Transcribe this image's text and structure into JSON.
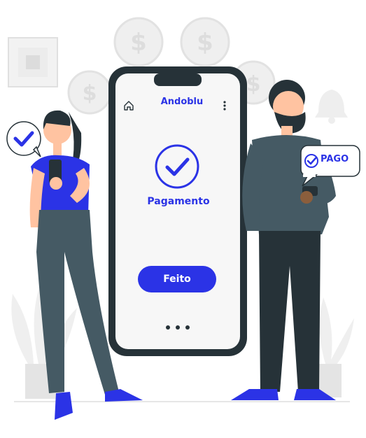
{
  "app": {
    "brand": "Andoblu",
    "status_title": "Pagamento",
    "done_label": "Feito"
  },
  "icons": {
    "home": "home-icon",
    "menu": "more-vertical-icon",
    "success": "check-circle-icon",
    "carousel": "pagination-dots-icon"
  },
  "badge": {
    "label": "PAGO",
    "icon": "check-circle-icon"
  },
  "colors": {
    "accent": "#2b33e6",
    "person_top": "#455a64",
    "coin": "#e6e6e6"
  }
}
